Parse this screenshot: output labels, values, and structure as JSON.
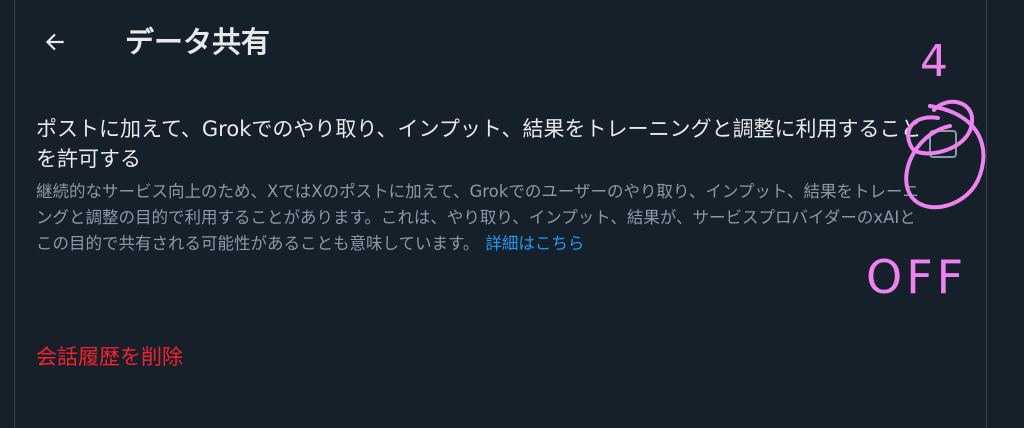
{
  "header": {
    "title": "データ共有",
    "back_icon": "arrow-left-icon"
  },
  "setting": {
    "label": "ポストに加えて、Grokでのやり取り、インプット、結果をトレーニングと調整に利用することを許可する",
    "description": "継続的なサービス向上のため、XではXのポストに加えて、Grokでのユーザーのやり取り、インプット、結果をトレーニングと調整の目的で利用することがあります。これは、やり取り、インプット、結果が、サービスプロバイダーのxAIとこの目的で共有される可能性があることも意味しています。",
    "learn_more": "詳細はこちら",
    "checked": false
  },
  "actions": {
    "delete_history": "会話履歴を削除"
  },
  "annotation": {
    "number": "4",
    "text": "OFF",
    "color": "#ee82ee"
  },
  "colors": {
    "background": "#15202b",
    "text_primary": "#e7e9ea",
    "text_secondary": "#8b98a5",
    "link": "#1d9bf0",
    "danger": "#f4212e",
    "border": "#38444d"
  }
}
